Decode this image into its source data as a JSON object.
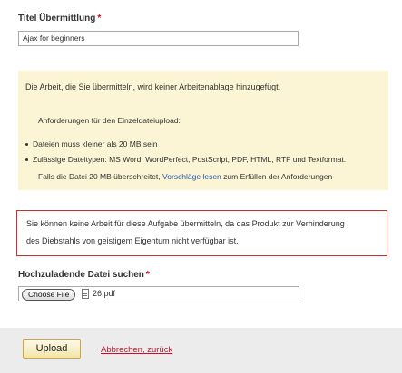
{
  "title_field": {
    "label": "Titel Übermittlung",
    "required_mark": "*",
    "value": "Ajax for beginners"
  },
  "notice": {
    "text": "Die Arbeit, die Sie übermitteln, wird keiner Arbeitenablage hinzugefügt."
  },
  "requirements": {
    "heading": "Anforderungen für den Einzeldateiupload:",
    "items": [
      "Dateien muss kleiner als 20 MB sein",
      "Zulässige Dateitypen: MS Word, WordPerfect, PostScript, PDF, HTML, RTF und Textformat."
    ],
    "footnote_before": "Falls die Datei 20 MB überschreitet,",
    "footnote_link": "Vorschläge lesen",
    "footnote_after": "zum Erfüllen der Anforderungen"
  },
  "error": {
    "line1": "Sie können keine Arbeit für diese Aufgabe übermitteln, da das Produkt zur Verhinderung",
    "line2": "des Diebstahls von geistigem Eigentum nicht verfügbar ist."
  },
  "file_field": {
    "label": "Hochzuladende Datei suchen",
    "required_mark": "*",
    "button_label": "Choose File",
    "file_name": "26.pdf",
    "file_icon": "document-icon"
  },
  "footer": {
    "upload_label": "Upload",
    "cancel_label": "Abbrechen, zurück"
  },
  "colors": {
    "required": "#e2001a",
    "notice_bg": "#fbf5d5",
    "error_border": "#c8302a",
    "link_blue": "#2a5aa8",
    "cancel_red": "#c8102e",
    "footer_bg": "#ececec"
  }
}
